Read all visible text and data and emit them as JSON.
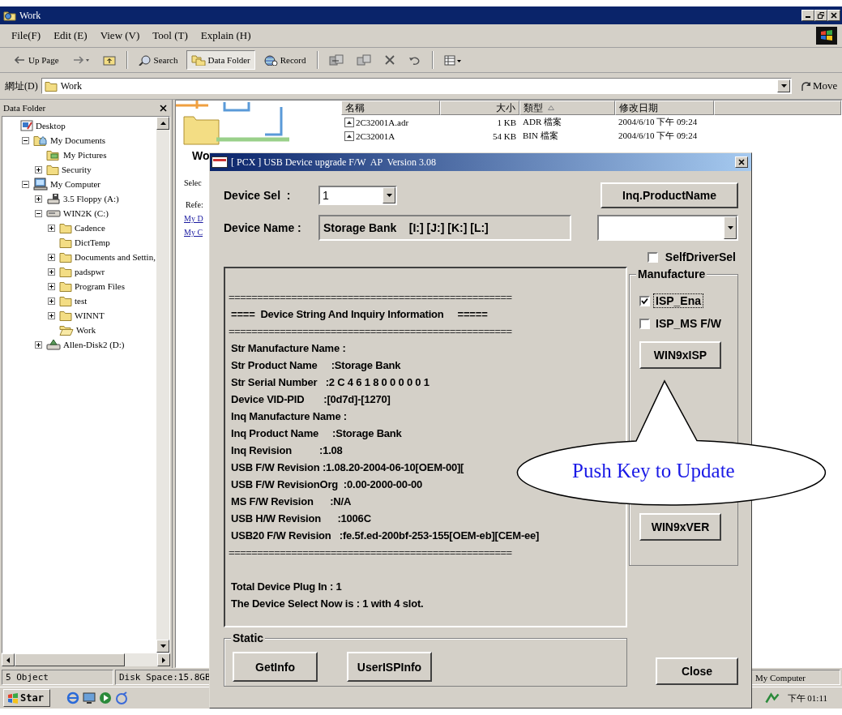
{
  "window": {
    "title": "Work"
  },
  "menu": [
    "File(F)",
    "Edit (E)",
    "View (V)",
    "Tool (T)",
    "Explain (H)"
  ],
  "toolbar": [
    {
      "kind": "back",
      "label": "Up Page",
      "pressed": false
    },
    {
      "kind": "forward",
      "pressed": false
    },
    {
      "kind": "up",
      "pressed": false
    },
    {
      "kind": "search",
      "label": "Search",
      "pressed": false
    },
    {
      "kind": "folders",
      "label": "Data Folder",
      "pressed": true
    },
    {
      "kind": "history",
      "label": "Record",
      "pressed": false
    },
    {
      "kind": "move",
      "pressed": false
    },
    {
      "kind": "copy",
      "pressed": false
    },
    {
      "kind": "delete",
      "pressed": false
    },
    {
      "kind": "undo",
      "pressed": false
    },
    {
      "kind": "views",
      "pressed": false
    }
  ],
  "address": {
    "label": "網址(D)",
    "value": "Work",
    "go_label": "Move"
  },
  "folder_pane": {
    "title": "Data Folder",
    "tree": [
      {
        "label": "Desktop",
        "kind": "desktop",
        "children": [
          {
            "label": "My Documents",
            "kind": "documents",
            "expanded": true,
            "children": [
              {
                "label": "My Pictures",
                "kind": "pictures"
              },
              {
                "label": "Security",
                "kind": "folder",
                "expanded": false
              }
            ]
          },
          {
            "label": "My Computer",
            "kind": "computer",
            "expanded": true,
            "children": [
              {
                "label": "3.5 Floppy (A:)",
                "kind": "floppy",
                "expanded": false
              },
              {
                "label": "WIN2K (C:)",
                "kind": "drive",
                "expanded": true,
                "children": [
                  {
                    "label": "Cadence",
                    "kind": "folder",
                    "expanded": false
                  },
                  {
                    "label": "DictTemp",
                    "kind": "folder"
                  },
                  {
                    "label": "Documents and Settin,",
                    "kind": "folder",
                    "expanded": false
                  },
                  {
                    "label": "padspwr",
                    "kind": "folder",
                    "expanded": false
                  },
                  {
                    "label": "Program Files",
                    "kind": "folder",
                    "expanded": false
                  },
                  {
                    "label": "test",
                    "kind": "folder",
                    "expanded": false
                  },
                  {
                    "label": "WINNT",
                    "kind": "folder",
                    "expanded": false
                  },
                  {
                    "label": "Work",
                    "kind": "folder-open"
                  }
                ]
              },
              {
                "label": "Allen-Disk2 (D:)",
                "kind": "netdrive",
                "expanded": false
              }
            ]
          }
        ]
      }
    ]
  },
  "web_view": {
    "heading": "Wo",
    "intro": "Selec",
    "refer": "Refe:",
    "links": [
      "My D",
      "My C"
    ]
  },
  "file_list": {
    "columns": [
      {
        "label": "名稱",
        "sorted": false
      },
      {
        "label": "大小",
        "sorted": false
      },
      {
        "label": "類型",
        "sorted": true
      },
      {
        "label": "修改日期",
        "sorted": false
      }
    ],
    "rows": [
      {
        "name": "2C32001A.adr",
        "size": "1 KB",
        "type": "ADR 檔案",
        "modified": "2004/6/10 下午 09:24"
      },
      {
        "name": "2C32001A",
        "size": "54 KB",
        "type": "BIN 檔案",
        "modified": "2004/6/10 下午 09:24"
      }
    ]
  },
  "status_bar": {
    "objects": "5 Object",
    "disk": "Disk Space:15.8GB",
    "zone": "My Computer"
  },
  "taskbar": {
    "start": "Star",
    "clock": "下午 01:11"
  },
  "dialog": {
    "title": "[ PCX ] USB Device upgrade F/W  AP  Version 3.08",
    "device_sel": {
      "label": "Device Sel  :",
      "value": "1"
    },
    "inq_button": "Inq.ProductName",
    "device_name": {
      "label": "Device Name :",
      "value": "Storage Bank    [I:] [J:] [K:] [L:]"
    },
    "self_driver": {
      "label": "SelfDriverSel",
      "checked": false
    },
    "info_lines": [
      {
        "kind": "blank"
      },
      {
        "kind": "rule",
        "text": "=================================================="
      },
      {
        "kind": "text",
        "text": "====  Device String And Inquiry Information     ====="
      },
      {
        "kind": "rule",
        "text": "=================================================="
      },
      {
        "kind": "text",
        "text": "Str Manufacture Name :"
      },
      {
        "kind": "text",
        "text": "Str Product Name     :Storage Bank"
      },
      {
        "kind": "text",
        "text": "Str Serial Number   :2 C 4 6 1 8 0 0 0 0 0 1"
      },
      {
        "kind": "text",
        "text": "Device VID-PID       :[0d7d]-[1270]"
      },
      {
        "kind": "text",
        "text": "Inq Manufacture Name :"
      },
      {
        "kind": "text",
        "text": "Inq Product Name     :Storage Bank"
      },
      {
        "kind": "text",
        "text": "Inq Revision          :1.08"
      },
      {
        "kind": "text",
        "text": "USB F/W Revision :1.08.20-2004-06-10[OEM-00]["
      },
      {
        "kind": "text",
        "text": "USB F/W RevisionOrg  :0.00-2000-00-00"
      },
      {
        "kind": "text",
        "text": "MS F/W Revision      :N/A"
      },
      {
        "kind": "text",
        "text": "USB H/W Revision      :1006C"
      },
      {
        "kind": "text",
        "text": "USB20 F/W Revision   :fe.5f.ed-200bf-253-155[OEM-eb][CEM-ee]"
      },
      {
        "kind": "rule",
        "text": "=================================================="
      },
      {
        "kind": "blank"
      },
      {
        "kind": "text",
        "text": "Total Device Plug In : 1"
      },
      {
        "kind": "text",
        "text": "The Device Select Now is : 1 with 4 slot."
      }
    ],
    "manufacture": {
      "title": "Manufacture",
      "options": [
        {
          "label": "ISP_Ena",
          "checked": true,
          "focused": true
        },
        {
          "label": "ISP_MS F/W",
          "checked": false,
          "focused": false
        }
      ],
      "isp_button": "WIN9xISP",
      "ver_button": "WIN9xVER"
    },
    "static": {
      "title": "Static",
      "buttons": [
        "GetInfo",
        "UserISPInfo"
      ]
    },
    "close_button": "Close"
  },
  "callout": {
    "text": "Push Key to Update"
  }
}
